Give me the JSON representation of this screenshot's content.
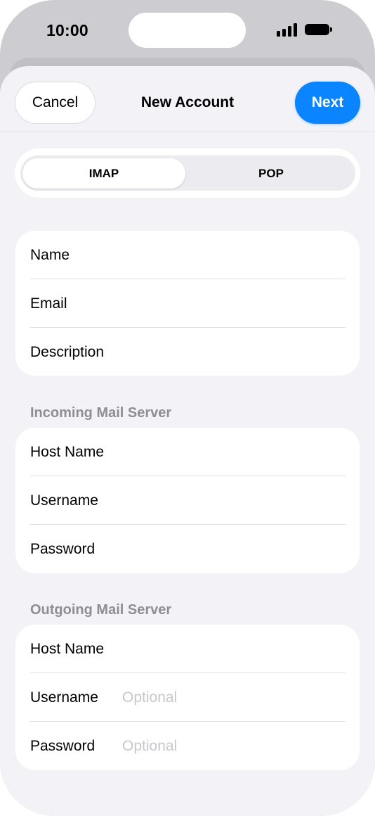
{
  "status_bar": {
    "time": "10:00",
    "signal_icon": "cellular-signal-icon",
    "battery_icon": "battery-icon"
  },
  "nav": {
    "cancel_label": "Cancel",
    "title": "New Account",
    "next_label": "Next"
  },
  "protocol": {
    "options": [
      "IMAP",
      "POP"
    ],
    "selected": "IMAP"
  },
  "account": {
    "rows": [
      {
        "label": "Name",
        "value": "",
        "placeholder": ""
      },
      {
        "label": "Email",
        "value": "",
        "placeholder": ""
      },
      {
        "label": "Description",
        "value": "",
        "placeholder": ""
      }
    ]
  },
  "incoming": {
    "header": "Incoming Mail Server",
    "rows": [
      {
        "label": "Host Name",
        "value": "",
        "placeholder": ""
      },
      {
        "label": "Username",
        "value": "",
        "placeholder": ""
      },
      {
        "label": "Password",
        "value": "",
        "placeholder": ""
      }
    ]
  },
  "outgoing": {
    "header": "Outgoing Mail Server",
    "rows": [
      {
        "label": "Host Name",
        "value": "",
        "placeholder": ""
      },
      {
        "label": "Username",
        "value": "",
        "placeholder": "Optional"
      },
      {
        "label": "Password",
        "value": "",
        "placeholder": "Optional"
      }
    ]
  },
  "colors": {
    "accent": "#0a84ff",
    "sheet_background": "#f2f2f7",
    "secondary_text": "#8e8e93",
    "placeholder_text": "#c7c7cc"
  }
}
